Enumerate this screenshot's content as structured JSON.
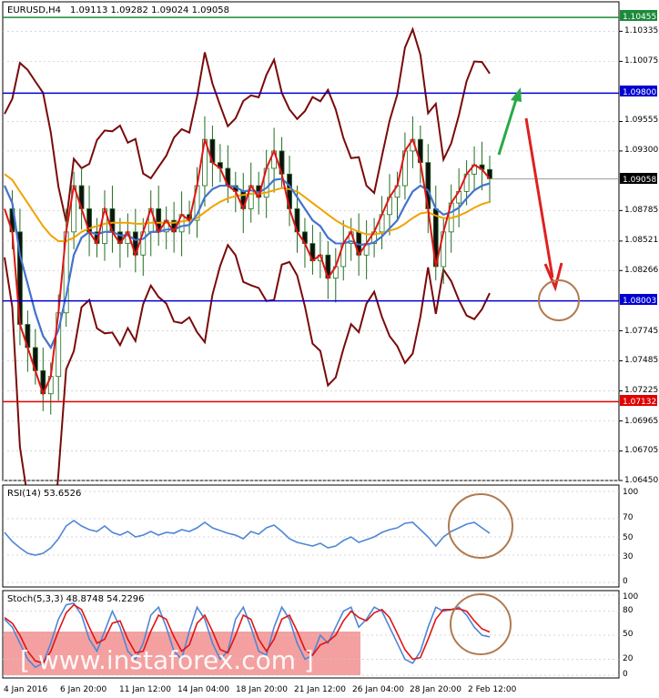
{
  "colors": {
    "frame": "#000000",
    "grid": "#c8c8c8",
    "bg": "#ffffff",
    "candle": "#1f6d1f",
    "ema_fast": "#e01414",
    "ema_mid": "#3b78d8",
    "ema_slow": "#f0a300",
    "bb": "#7a0a0a",
    "level_resistance": "#0000d0",
    "level_top": "#1b8a3a",
    "level_support": "#0000d0",
    "level_low": "#e00000",
    "rsi_line": "#4f86d6",
    "stoch_k": "#4f86d6",
    "stoch_d": "#e01414",
    "arrow_up": "#2aa84a",
    "arrow_down": "#e02020",
    "circle": "#b07a50",
    "watermark_bg": "#f08080"
  },
  "header": {
    "symbol": "EURUSD,H4",
    "ohlc": "1.09113 1.09282 1.09024 1.09058"
  },
  "price_axis": {
    "ticks": [
      "1.10335",
      "1.10075",
      "1.09555",
      "1.09300",
      "1.08785",
      "1.08521",
      "1.08266",
      "1.07745",
      "1.07485",
      "1.07225",
      "1.06965",
      "1.06705",
      "1.06450"
    ]
  },
  "levels": [
    {
      "name": "level-top",
      "value": 1.10455,
      "label": "1.10455",
      "color": "#1b8a3a"
    },
    {
      "name": "level-resistance",
      "value": 1.098,
      "label": "1.09800",
      "color": "#0000d0"
    },
    {
      "name": "level-current",
      "value": 1.09058,
      "label": "1.09058",
      "color": "#000000"
    },
    {
      "name": "level-support",
      "value": 1.08003,
      "label": "1.08003",
      "color": "#0000d0"
    },
    {
      "name": "level-low",
      "value": 1.07132,
      "label": "1.07132",
      "color": "#e00000"
    }
  ],
  "rsi": {
    "label": "RSI(14) 53.6526",
    "ticks": [
      "100",
      "70",
      "50",
      "30",
      "0"
    ]
  },
  "stoch": {
    "label": "Stoch(5,3,3) 48.8748 54.2296",
    "ticks": [
      "100",
      "80",
      "50",
      "20",
      "0"
    ]
  },
  "time_axis": {
    "ticks": [
      "4 Jan 2016",
      "6 Jan 20:00",
      "11 Jan 12:00",
      "14 Jan 04:00",
      "18 Jan 20:00",
      "21 Jan 12:00",
      "26 Jan 04:00",
      "28 Jan 20:00",
      "2 Feb 12:00"
    ]
  },
  "watermark": "[ www.instaforex.com ]",
  "chart_data": [
    {
      "type": "line",
      "title": "EURUSD,H4",
      "ylim": [
        1.0645,
        1.1059
      ],
      "x_ticks": [
        "4 Jan 2016",
        "6 Jan 20:00",
        "11 Jan 12:00",
        "14 Jan 04:00",
        "18 Jan 20:00",
        "21 Jan 12:00",
        "26 Jan 04:00",
        "28 Jan 20:00",
        "2 Feb 12:00"
      ],
      "series": [
        {
          "values": [
            1.088,
            1.086,
            1.078,
            1.076,
            1.074,
            1.072,
            1.0735,
            1.079,
            1.086,
            1.09,
            1.088,
            1.086,
            1.085,
            1.088,
            1.086,
            1.085,
            1.086,
            1.084,
            1.086,
            1.088,
            1.086,
            1.087,
            1.086,
            1.0875,
            1.087,
            1.09,
            1.094,
            1.092,
            1.0915,
            1.09,
            1.0895,
            1.088,
            1.09,
            1.089,
            1.0915,
            1.093,
            1.091,
            1.088,
            1.086,
            1.085,
            1.0835,
            1.084,
            1.082,
            1.083,
            1.085,
            1.086,
            1.084,
            1.085,
            1.086,
            1.0875,
            1.089,
            1.09,
            1.093,
            1.094,
            1.092,
            1.088,
            1.083,
            1.086,
            1.0885,
            1.0895,
            1.091,
            1.0918,
            1.0914,
            1.0906
          ]
        },
        {
          "values": [
            1.09,
            1.0885,
            1.084,
            1.0815,
            1.079,
            1.077,
            1.076,
            1.0775,
            1.0805,
            1.084,
            1.0855,
            1.086,
            1.0858,
            1.086,
            1.086,
            1.0857,
            1.0857,
            1.0853,
            1.0854,
            1.086,
            1.086,
            1.0862,
            1.0862,
            1.0865,
            1.0866,
            1.0875,
            1.089,
            1.0897,
            1.09,
            1.09,
            1.0899,
            1.0895,
            1.0896,
            1.0894,
            1.0898,
            1.0905,
            1.0906,
            1.09,
            1.089,
            1.088,
            1.087,
            1.0865,
            1.0855,
            1.085,
            1.085,
            1.0852,
            1.0849,
            1.0849,
            1.0851,
            1.0856,
            1.0863,
            1.087,
            1.0883,
            1.0895,
            1.09,
            1.0896,
            1.088,
            1.0875,
            1.0877,
            1.0881,
            1.0889,
            1.0896,
            1.09,
            1.0902
          ]
        },
        {
          "values": [
            1.091,
            1.0905,
            1.0895,
            1.0885,
            1.0875,
            1.0865,
            1.0857,
            1.0852,
            1.0852,
            1.0855,
            1.086,
            1.0863,
            1.0865,
            1.0867,
            1.0868,
            1.0868,
            1.0868,
            1.0867,
            1.0867,
            1.0868,
            1.0868,
            1.0868,
            1.0868,
            1.0869,
            1.087,
            1.0872,
            1.0877,
            1.0882,
            1.0886,
            1.0889,
            1.0891,
            1.0892,
            1.0893,
            1.0893,
            1.0894,
            1.0896,
            1.0898,
            1.0897,
            1.0895,
            1.089,
            1.0885,
            1.088,
            1.0875,
            1.087,
            1.0866,
            1.0863,
            1.086,
            1.0858,
            1.0858,
            1.0859,
            1.0861,
            1.0863,
            1.0867,
            1.0872,
            1.0876,
            1.0877,
            1.0874,
            1.0872,
            1.0872,
            1.0874,
            1.0877,
            1.0881,
            1.0884,
            1.0886
          ]
        }
      ]
    },
    {
      "type": "line",
      "title": "RSI(14) 53.6526",
      "ylim": [
        0,
        100
      ],
      "series": [
        {
          "values": [
            55,
            45,
            38,
            32,
            30,
            32,
            38,
            48,
            62,
            68,
            62,
            58,
            56,
            62,
            55,
            52,
            56,
            50,
            52,
            56,
            52,
            55,
            54,
            58,
            56,
            60,
            66,
            60,
            57,
            54,
            52,
            48,
            56,
            53,
            60,
            63,
            56,
            48,
            44,
            42,
            40,
            43,
            38,
            40,
            46,
            50,
            44,
            47,
            50,
            55,
            58,
            60,
            65,
            66,
            58,
            50,
            40,
            50,
            56,
            60,
            64,
            66,
            60,
            54
          ]
        }
      ]
    },
    {
      "type": "line",
      "title": "Stoch(5,3,3) 48.8748 54.2296",
      "ylim": [
        0,
        100
      ],
      "series": [
        {
          "values": [
            70,
            60,
            40,
            20,
            10,
            15,
            40,
            70,
            88,
            90,
            75,
            45,
            30,
            55,
            80,
            60,
            30,
            20,
            40,
            75,
            85,
            60,
            30,
            20,
            55,
            85,
            70,
            40,
            20,
            30,
            70,
            85,
            60,
            30,
            25,
            60,
            85,
            70,
            40,
            20,
            25,
            50,
            40,
            60,
            80,
            85,
            60,
            70,
            85,
            80,
            60,
            40,
            20,
            15,
            30,
            60,
            85,
            80,
            82,
            85,
            75,
            60,
            50,
            48
          ]
        },
        {
          "values": [
            72,
            65,
            50,
            30,
            18,
            15,
            30,
            55,
            78,
            88,
            82,
            60,
            40,
            45,
            65,
            68,
            45,
            28,
            30,
            55,
            75,
            70,
            48,
            30,
            38,
            65,
            75,
            55,
            32,
            28,
            50,
            75,
            70,
            45,
            30,
            45,
            70,
            75,
            55,
            32,
            25,
            38,
            42,
            50,
            68,
            80,
            72,
            68,
            78,
            82,
            72,
            52,
            32,
            20,
            22,
            45,
            70,
            82,
            82,
            83,
            80,
            68,
            58,
            54
          ]
        }
      ]
    }
  ]
}
